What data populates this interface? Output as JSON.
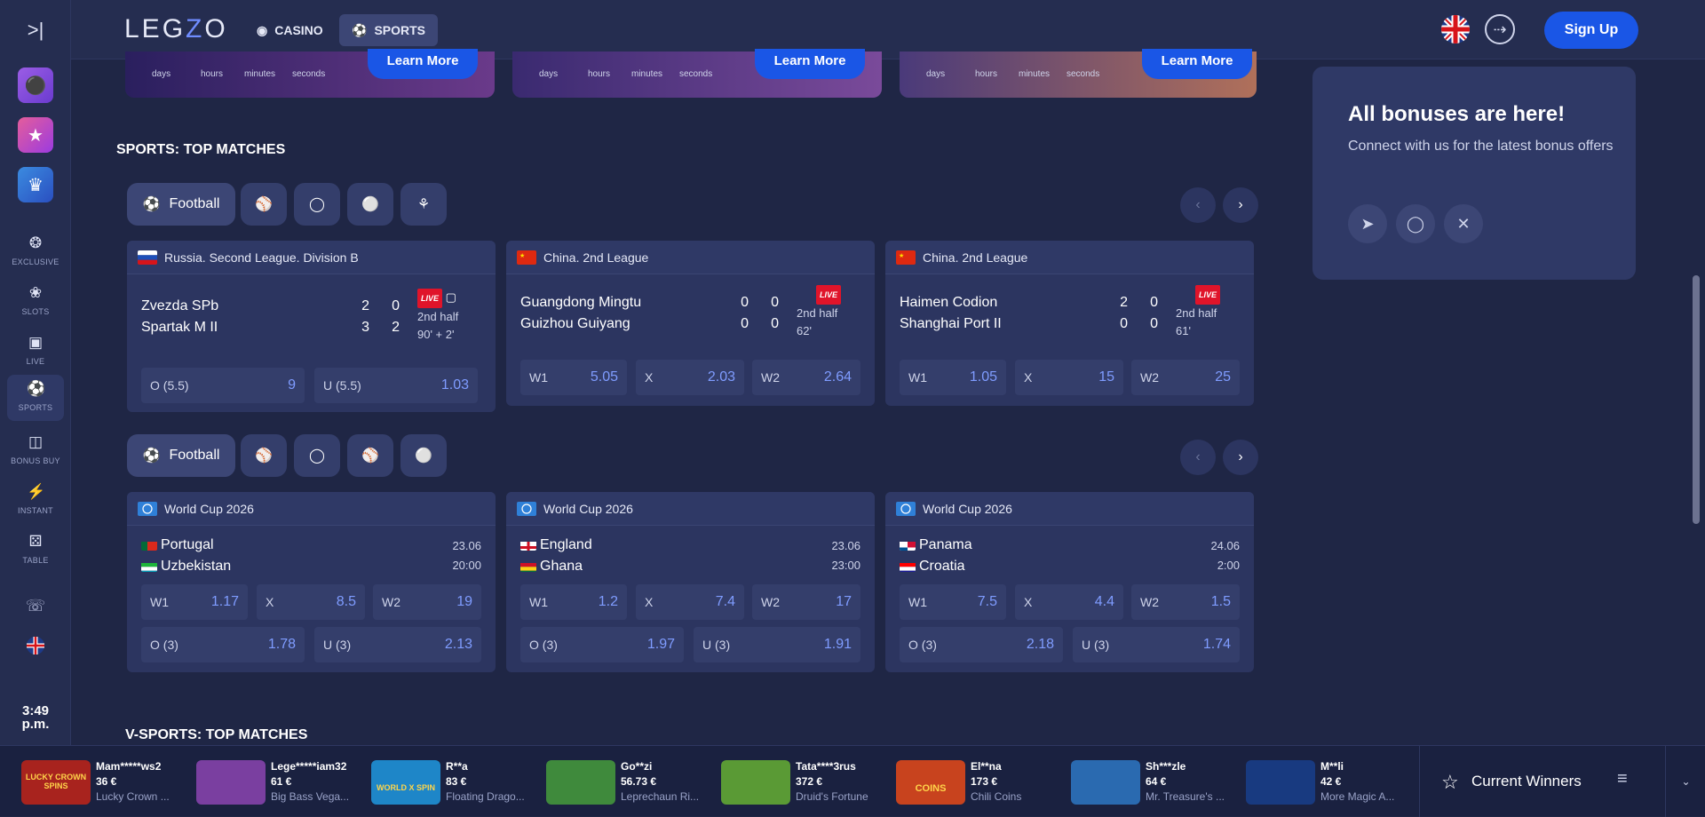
{
  "header": {
    "logo_a": "LEG",
    "logo_b": "Z",
    "logo_c": "O",
    "casino": "CASINO",
    "sports": "SPORTS",
    "signup": "Sign Up"
  },
  "sidebar": {
    "items": [
      {
        "label": "EXCLUSIVE"
      },
      {
        "label": "SLOTS"
      },
      {
        "label": "LIVE"
      },
      {
        "label": "SPORTS"
      },
      {
        "label": "BONUS BUY"
      },
      {
        "label": "INSTANT"
      },
      {
        "label": "TABLE"
      }
    ],
    "time": "3:49",
    "ampm": "p.m."
  },
  "promo": {
    "days": "days",
    "hours": "hours",
    "minutes": "minutes",
    "seconds": "seconds",
    "learn_more": "Learn More"
  },
  "sports_title": "SPORTS: TOP MATCHES",
  "vsports_title": "V-SPORTS: TOP MATCHES",
  "tabs1": {
    "football": "Football"
  },
  "tabs2": {
    "football": "Football"
  },
  "row1": [
    {
      "league": "Russia. Second League. Division B",
      "team1": "Zvezda SPb",
      "team2": "Spartak M II",
      "s1a": "2",
      "s1b": "0",
      "s2a": "3",
      "s2b": "2",
      "live": "LIVE",
      "period": "2nd half",
      "time": "90' + 2'",
      "o1l": "O (5.5)",
      "o1v": "9",
      "o2l": "U (5.5)",
      "o2v": "1.03"
    },
    {
      "league": "China. 2nd League",
      "team1": "Guangdong Mingtu",
      "team2": "Guizhou Guiyang",
      "s1a": "0",
      "s1b": "0",
      "s2a": "0",
      "s2b": "0",
      "live": "LIVE",
      "period": "2nd half",
      "time": "62'",
      "o1l": "W1",
      "o1v": "5.05",
      "o2l": "X",
      "o2v": "2.03",
      "o3l": "W2",
      "o3v": "2.64"
    },
    {
      "league": "China. 2nd League",
      "team1": "Haimen Codion",
      "team2": "Shanghai Port II",
      "s1a": "2",
      "s1b": "0",
      "s2a": "0",
      "s2b": "0",
      "live": "LIVE",
      "period": "2nd half",
      "time": "61'",
      "o1l": "W1",
      "o1v": "1.05",
      "o2l": "X",
      "o2v": "15",
      "o3l": "W2",
      "o3v": "25"
    }
  ],
  "row2": [
    {
      "league": "World Cup 2026",
      "team1": "Portugal",
      "team2": "Uzbekistan",
      "date": "23.06",
      "time": "20:00",
      "w1": "1.17",
      "x": "8.5",
      "w2": "19",
      "o": "1.78",
      "u": "2.13"
    },
    {
      "league": "World Cup 2026",
      "team1": "England",
      "team2": "Ghana",
      "date": "23.06",
      "time": "23:00",
      "w1": "1.2",
      "x": "7.4",
      "w2": "17",
      "o": "1.97",
      "u": "1.91"
    },
    {
      "league": "World Cup 2026",
      "team1": "Panama",
      "team2": "Croatia",
      "date": "24.06",
      "time": "2:00",
      "w1": "7.5",
      "x": "4.4",
      "w2": "1.5",
      "o": "2.18",
      "u": "1.74"
    }
  ],
  "odd_labels": {
    "w1": "W1",
    "x": "X",
    "w2": "W2",
    "o": "O (3)",
    "u": "U (3)"
  },
  "bonus": {
    "title": "All bonuses are here!",
    "text": "Connect with us for the latest bonus offers"
  },
  "winners": [
    {
      "name": "Mam*****ws2",
      "amount": "36 €",
      "game": "Lucky Crown ...",
      "color": "#a8231e",
      "thumb": "LUCKY CROWN SPINS"
    },
    {
      "name": "Lege*****iam32",
      "amount": "61 €",
      "game": "Big Bass Vega...",
      "color": "#7a3fa0",
      "thumb": ""
    },
    {
      "name": "R**a",
      "amount": "83 €",
      "game": "Floating Drago...",
      "color": "#1e86c8",
      "thumb": "WORLD X SPIN"
    },
    {
      "name": "Go**zi",
      "amount": "56.73 €",
      "game": "Leprechaun Ri...",
      "color": "#3f8a3c",
      "thumb": ""
    },
    {
      "name": "Tata****3rus",
      "amount": "372 €",
      "game": "Druid's Fortune",
      "color": "#5a9a35",
      "thumb": ""
    },
    {
      "name": "El**na",
      "amount": "173 €",
      "game": "Chili Coins",
      "color": "#c8431e",
      "thumb": "COINS"
    },
    {
      "name": "Sh***zle",
      "amount": "64 €",
      "game": "Mr. Treasure's ...",
      "color": "#2a6ab0",
      "thumb": ""
    },
    {
      "name": "M**li",
      "amount": "42 €",
      "game": "More Magic A...",
      "color": "#183a80",
      "thumb": ""
    }
  ],
  "current_winners": "Current Winners",
  "colors": {
    "accent": "#1a56e6",
    "odds": "#7f9cff",
    "live": "#e0142a"
  }
}
